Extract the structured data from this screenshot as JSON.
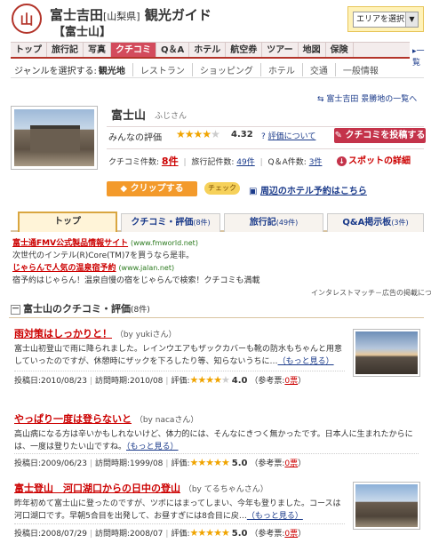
{
  "header": {
    "logo_char": "山",
    "title": "富士吉田",
    "prefecture": "[山梨県]",
    "title_suffix": "観光ガイド",
    "subtitle": "【富士山】",
    "area_select": "エリアを選択"
  },
  "nav": {
    "tabs": [
      "トップ",
      "旅行記",
      "写真",
      "クチコミ",
      "Q＆A",
      "ホテル",
      "航空券",
      "ツアー",
      "地図",
      "保険"
    ],
    "active_index": 3,
    "list_link": "一覧"
  },
  "genre": {
    "label": "ジャンルを選択する:",
    "items": [
      "観光地",
      "レストラン",
      "ショッピング",
      "ホテル",
      "交通",
      "一般情報"
    ]
  },
  "list_link": "富士吉田 景勝地の一覧へ",
  "spot": {
    "name": "富士山",
    "kana": "ふじさん",
    "eval_label": "みんなの評価",
    "rating": 4.32,
    "rating_display": "4.32",
    "eval_help": "評価について",
    "post_button": "クチコミを投稿する",
    "counts": {
      "review_label": "クチコミ件数:",
      "review_count": "8件",
      "travel_label": "旅行記件数:",
      "travel_count": "49件",
      "qa_label": "Q＆A件数:",
      "qa_count": "3件"
    },
    "detail_link": "スポットの詳細",
    "clip_button": "クリップする",
    "check_badge": "チェック",
    "hotel_link": "周辺のホテル予約はこちら"
  },
  "subtabs": [
    {
      "label": "トップ",
      "count": ""
    },
    {
      "label": "クチコミ・評価",
      "count": "(8件)"
    },
    {
      "label": "旅行記",
      "count": "(49件)"
    },
    {
      "label": "Q&A掲示板",
      "count": "(3件)"
    }
  ],
  "ads": {
    "ad1_title": "富士通FMV公式製品情報サイト",
    "ad1_url": "(www.fmworld.net)",
    "ad1_text": "次世代のインテル(R)Core(TM)7を買うなら是非。",
    "ad2_title": "じゃらんで人気の温泉宿予約",
    "ad2_url": "(www.jalan.net)",
    "ad2_text": "宿予約はじゃらん！温泉自慢の宿をじゃらんで検索！クチコミも満載",
    "note": "インタレストマッチ－広告の掲載について"
  },
  "reviews_section": {
    "title": "富士山のクチコミ・評価",
    "count": "(8件)",
    "toggle": "－"
  },
  "reviews": [
    {
      "title": "雨対策はしっかりと！",
      "by": "（by yukiさん）",
      "body": "富士山初登山で雨に降られました。レインウエアもザックカバーも靴の防水もちゃんと用意していったのですが、休憩時にザックを下ろしたり等、知らないうちに…",
      "more": "（もっと見る）",
      "posted_label": "投稿日:",
      "posted": "2010/08/23",
      "visited_label": "訪問時期:",
      "visited": "2010/08",
      "eval_label": "評価:",
      "rating": 4.0,
      "score": "4.0",
      "ref_label": "（参考票:",
      "ref": "0票",
      "ref_close": "）"
    },
    {
      "title": "やっぱり一度は登らないと",
      "by": "（by nacaさん）",
      "body": "高山病になる方は辛いかもしれないけど、体力的には、そんなにきつく無かったです。日本人に生まれたからには、一度は登りたい山ですね。",
      "more": "（もっと見る）",
      "posted_label": "投稿日:",
      "posted": "2009/06/23",
      "visited_label": "訪問時期:",
      "visited": "1999/08",
      "eval_label": "評価:",
      "rating": 5.0,
      "score": "5.0",
      "ref_label": "（参考票:",
      "ref": "0票",
      "ref_close": "）"
    },
    {
      "title": "富士登山　河口湖口からの日中の登山",
      "by": "（by てるちゃんさん）",
      "body": "昨年初めて富士山に登ったのですが、ツボにはまってしまい、今年も登りました。コースは河口湖口です。早朝5合目を出発して、お昼すぎには8合目に戻…",
      "more": "（もっと見る）",
      "posted_label": "投稿日:",
      "posted": "2008/07/29",
      "visited_label": "訪問時期:",
      "visited": "2008/07",
      "eval_label": "評価:",
      "rating": 5.0,
      "score": "5.0",
      "ref_label": "（参考票:",
      "ref": "0票",
      "ref_close": "）"
    }
  ]
}
